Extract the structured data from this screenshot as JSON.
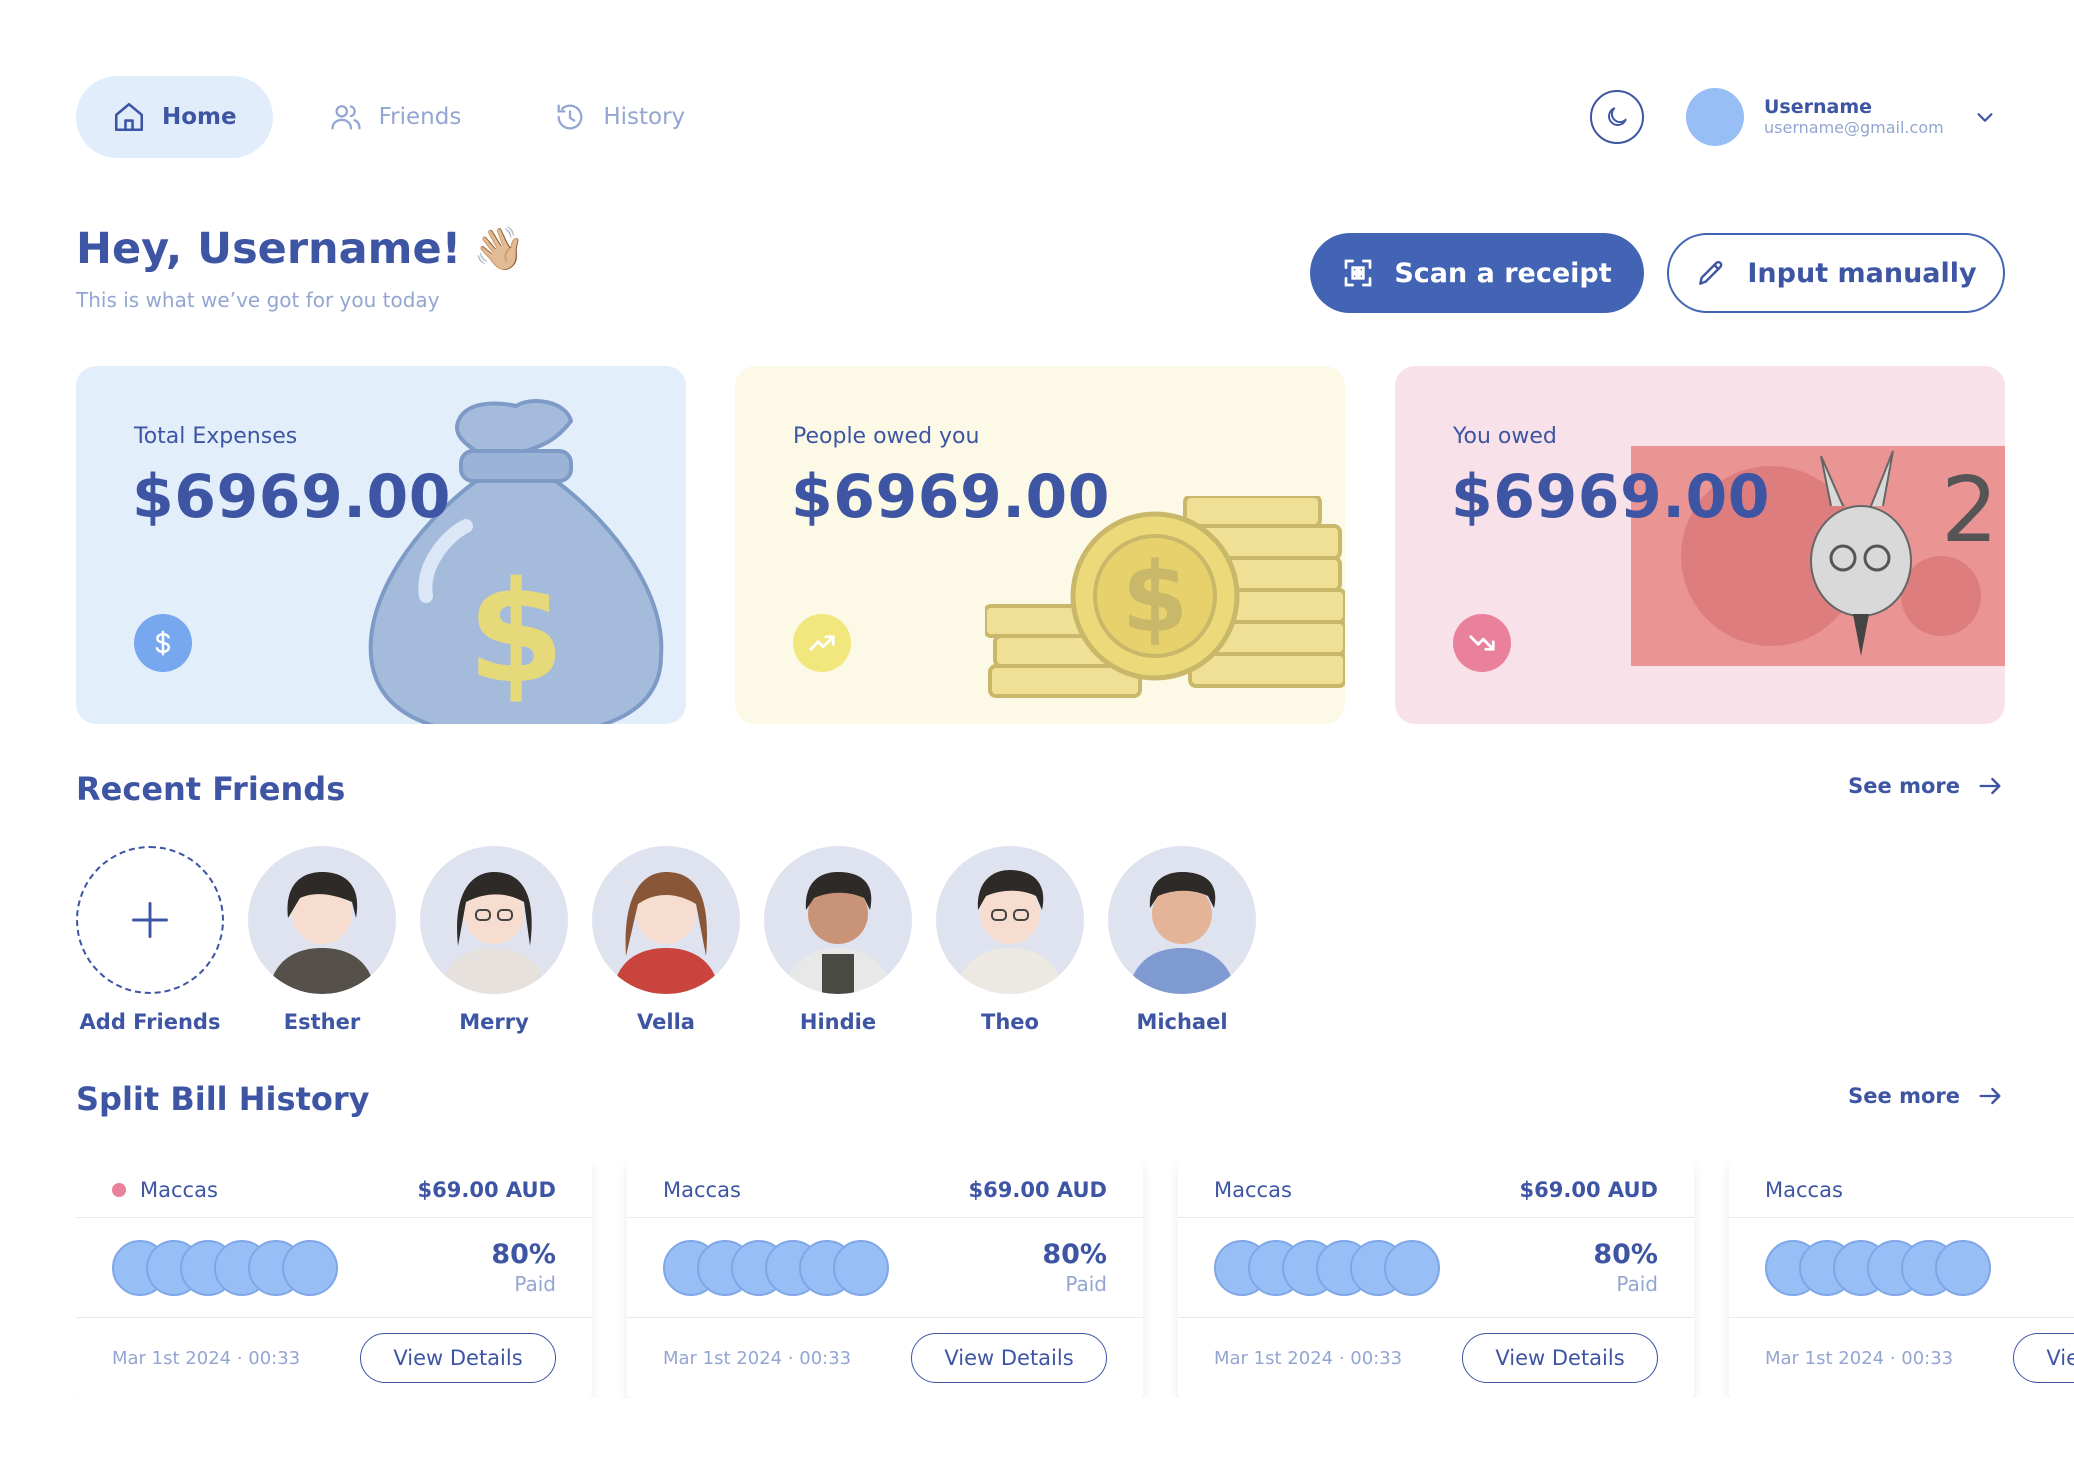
{
  "nav": {
    "items": [
      {
        "label": "Home",
        "active": true
      },
      {
        "label": "Friends",
        "active": false
      },
      {
        "label": "History",
        "active": false
      }
    ]
  },
  "user": {
    "name": "Username",
    "email": "username@gmail.com"
  },
  "greeting": {
    "title": "Hey, Username!",
    "emoji": "👋🏼",
    "subtitle": "This is what we’ve got for you today"
  },
  "actions": {
    "scan_label": "Scan a receipt",
    "manual_label": "Input manually"
  },
  "stats": [
    {
      "label": "Total Expenses",
      "amount": "$6969.00",
      "icon": "dollar-icon",
      "color": "#e3eefb"
    },
    {
      "label": "People owed you",
      "amount": "$6969.00",
      "icon": "trending-up-icon",
      "color": "#fcfae6"
    },
    {
      "label": "You owed",
      "amount": "$6969.00",
      "icon": "trending-down-icon",
      "color": "#f8e1e8"
    }
  ],
  "recent_friends": {
    "title": "Recent Friends",
    "see_more": "See more",
    "add_label": "Add Friends",
    "friends": [
      {
        "name": "Esther"
      },
      {
        "name": "Merry"
      },
      {
        "name": "Vella"
      },
      {
        "name": "Hindie"
      },
      {
        "name": "Theo"
      },
      {
        "name": "Michael"
      }
    ]
  },
  "history": {
    "title": "Split Bill History",
    "see_more": "See more",
    "bills": [
      {
        "shop": "Maccas",
        "amount": "$69.00 AUD",
        "percent": "80%",
        "paid_label": "Paid",
        "date": "Mar 1st 2024 · 00:33",
        "button": "View Details"
      },
      {
        "shop": "Maccas",
        "amount": "$69.00 AUD",
        "percent": "80%",
        "paid_label": "Paid",
        "date": "Mar 1st 2024 · 00:33",
        "button": "View Details"
      },
      {
        "shop": "Maccas",
        "amount": "$69.00 AUD",
        "percent": "80%",
        "paid_label": "Paid",
        "date": "Mar 1st 2024 · 00:33",
        "button": "View Details"
      },
      {
        "shop": "Maccas",
        "amount": "",
        "percent": "",
        "paid_label": "",
        "date": "Mar 1st 2024 · 00:33",
        "button": "View Details"
      }
    ]
  },
  "colors": {
    "primary": "#3d55a3",
    "button": "#4364b4",
    "muted": "#93a6d2",
    "avatar": "#97bff6",
    "unpaid_dot": "#e9809c"
  }
}
